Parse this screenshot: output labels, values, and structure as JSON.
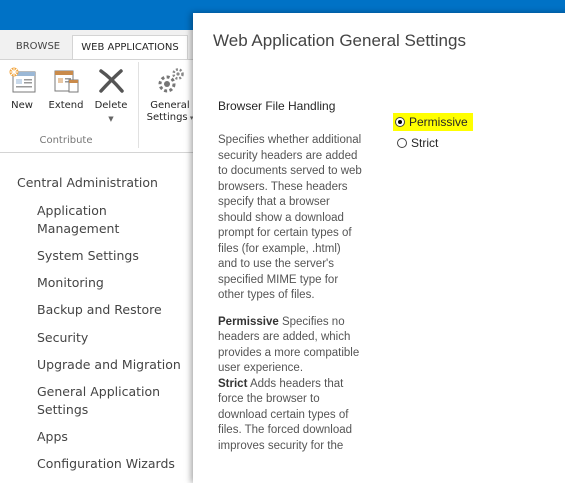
{
  "ribbon": {
    "tabs": [
      "BROWSE",
      "WEB APPLICATIONS"
    ],
    "buttons": {
      "new": "New",
      "extend": "Extend",
      "delete": "Delete",
      "general_settings_line1": "General",
      "general_settings_line2": "Settings"
    },
    "group_contribute": "Contribute"
  },
  "nav": {
    "root": "Central Administration",
    "items": [
      "Application Management",
      "System Settings",
      "Monitoring",
      "Backup and Restore",
      "Security",
      "Upgrade and Migration",
      "General Application Settings",
      "Apps",
      "Configuration Wizards"
    ]
  },
  "dialog": {
    "title": "Web Application General Settings",
    "section_title": "Browser File Handling",
    "description": "Specifies whether additional security headers are added to documents served to web browsers. These headers specify that a browser should show a download prompt for certain types of files (for example, .html) and to use the server's specified MIME type for other types of files.",
    "permissive_term": "Permissive",
    "permissive_text": " Specifies no headers are added, which provides a more compatible user experience.",
    "strict_term": "Strict",
    "strict_text": " Adds headers that force the browser to download certain types of files. The forced download improves security for the",
    "options": [
      {
        "label": "Permissive",
        "selected": true
      },
      {
        "label": "Strict",
        "selected": false
      }
    ],
    "highlight_color": "#ffff00"
  },
  "colors": {
    "topbar": "#0072c6"
  }
}
